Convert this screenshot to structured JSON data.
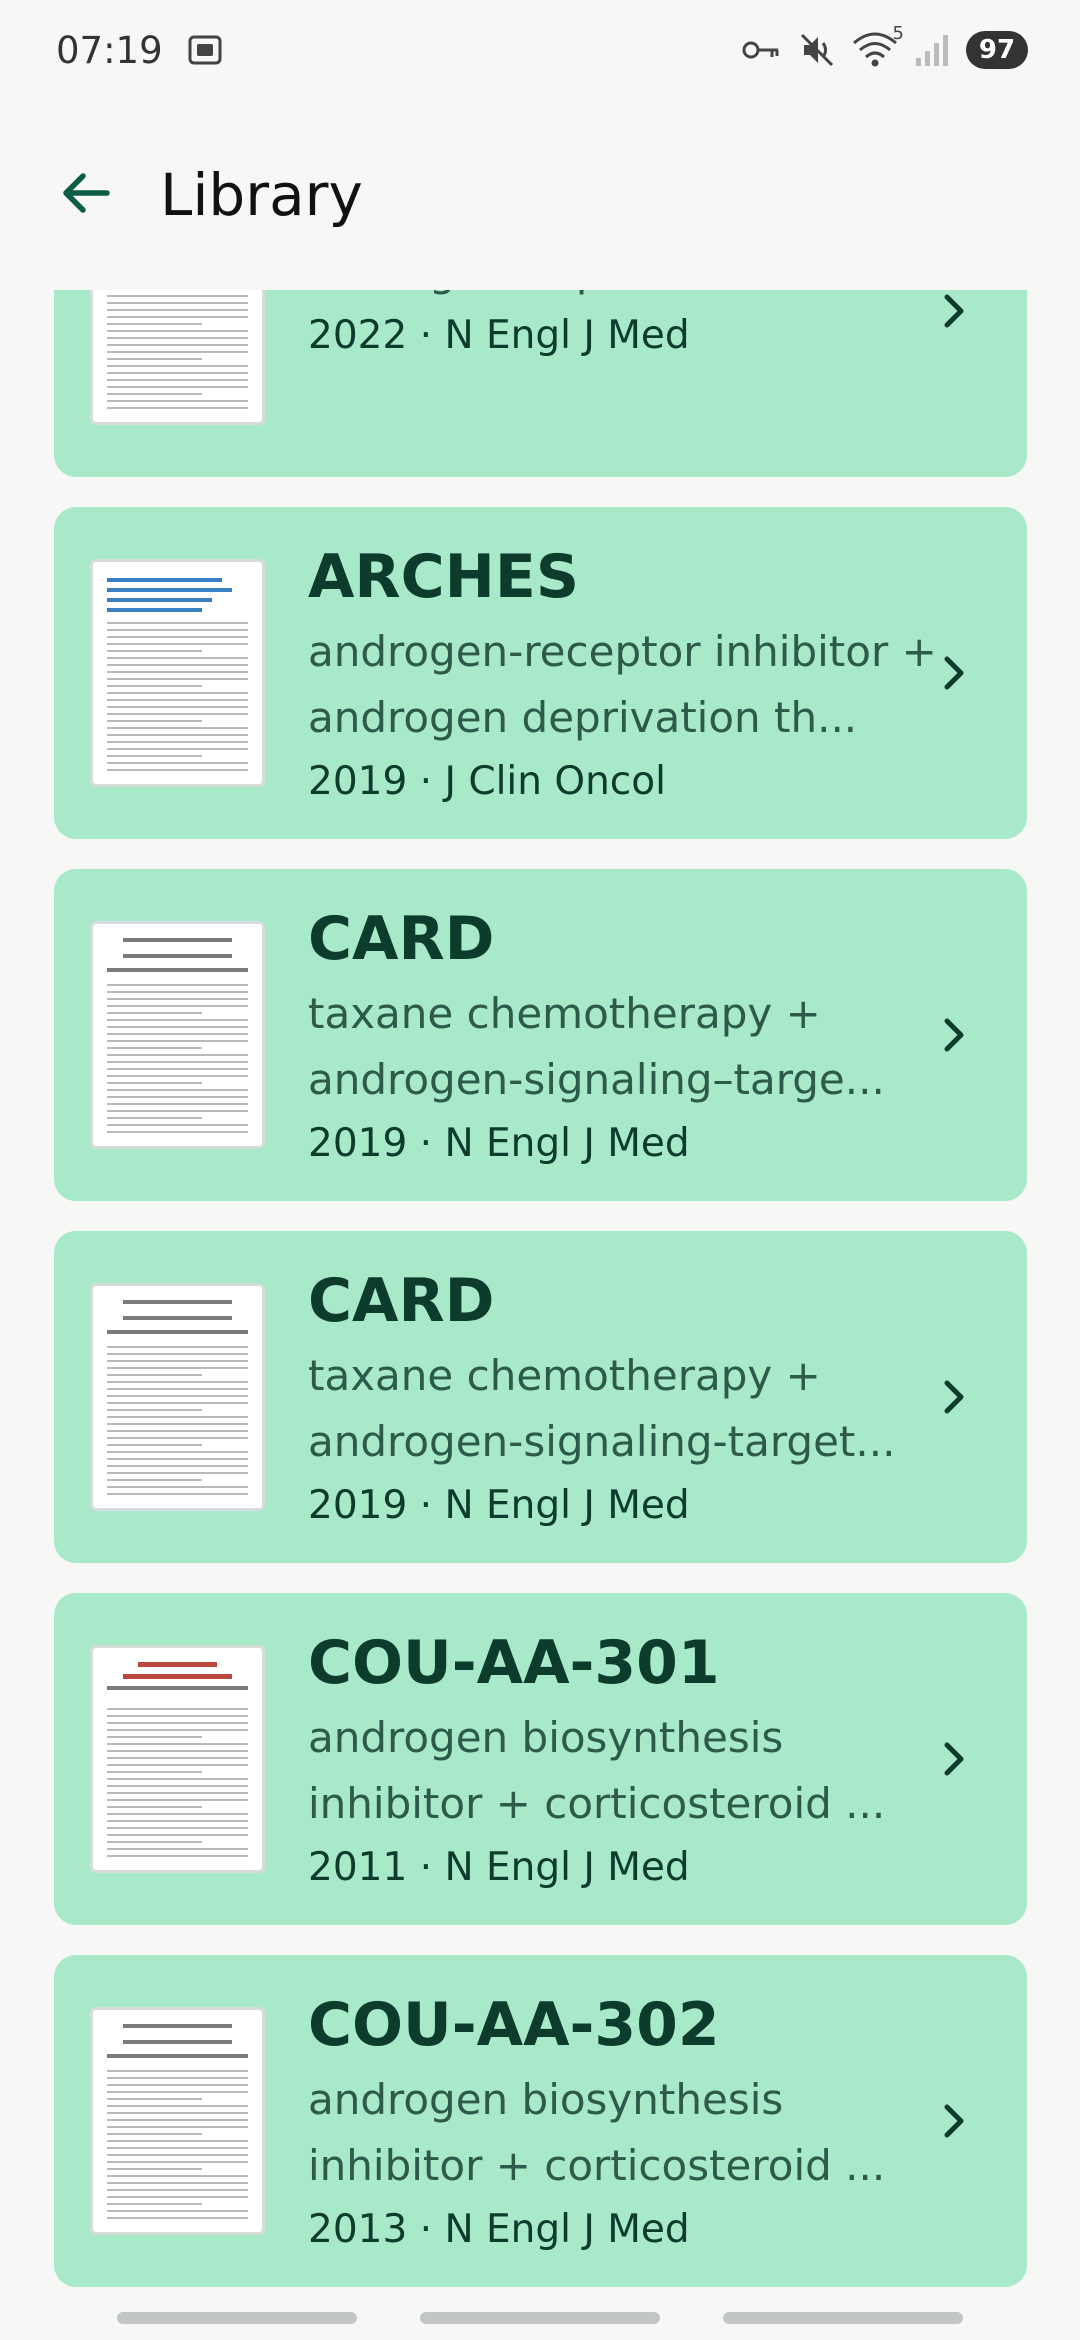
{
  "status_bar": {
    "time": "07:19",
    "battery": "97",
    "wifi_badge": "5",
    "icons": [
      "screenshot-icon",
      "vpn-key-icon",
      "mute-icon",
      "wifi-icon",
      "cellular-signal-icon"
    ]
  },
  "app_bar": {
    "title": "Library",
    "back_icon": "back-arrow-icon"
  },
  "items": [
    {
      "title": "",
      "desc": "androgen-receptor inhibitor + androgen-deprivation th...",
      "year": "2022",
      "journal": "N Engl J Med",
      "thumb_style": "plain"
    },
    {
      "title": "ARCHES",
      "desc": "androgen-receptor inhibitor + androgen deprivation th...",
      "year": "2019",
      "journal": "J Clin Oncol",
      "thumb_style": "blue"
    },
    {
      "title": "CARD",
      "desc": "taxane chemotherapy + androgen-signaling–targe...",
      "year": "2019",
      "journal": "N Engl J Med",
      "thumb_style": "nejm"
    },
    {
      "title": "CARD",
      "desc": "taxane chemotherapy + androgen-signaling-target...",
      "year": "2019",
      "journal": "N Engl J Med",
      "thumb_style": "nejm"
    },
    {
      "title": "COU-AA-301",
      "desc": "androgen biosynthesis inhibitor + corticosteroid ...",
      "year": "2011",
      "journal": "N Engl J Med",
      "thumb_style": "red"
    },
    {
      "title": "COU-AA-302",
      "desc": "androgen biosynthesis inhibitor + corticosteroid ...",
      "year": "2013",
      "journal": "N Engl J Med",
      "thumb_style": "nejm"
    }
  ],
  "meta_separator": " · ",
  "colors": {
    "card": "#a8e9ca",
    "title": "#0d3b2c",
    "accent": "#0d5c45"
  }
}
